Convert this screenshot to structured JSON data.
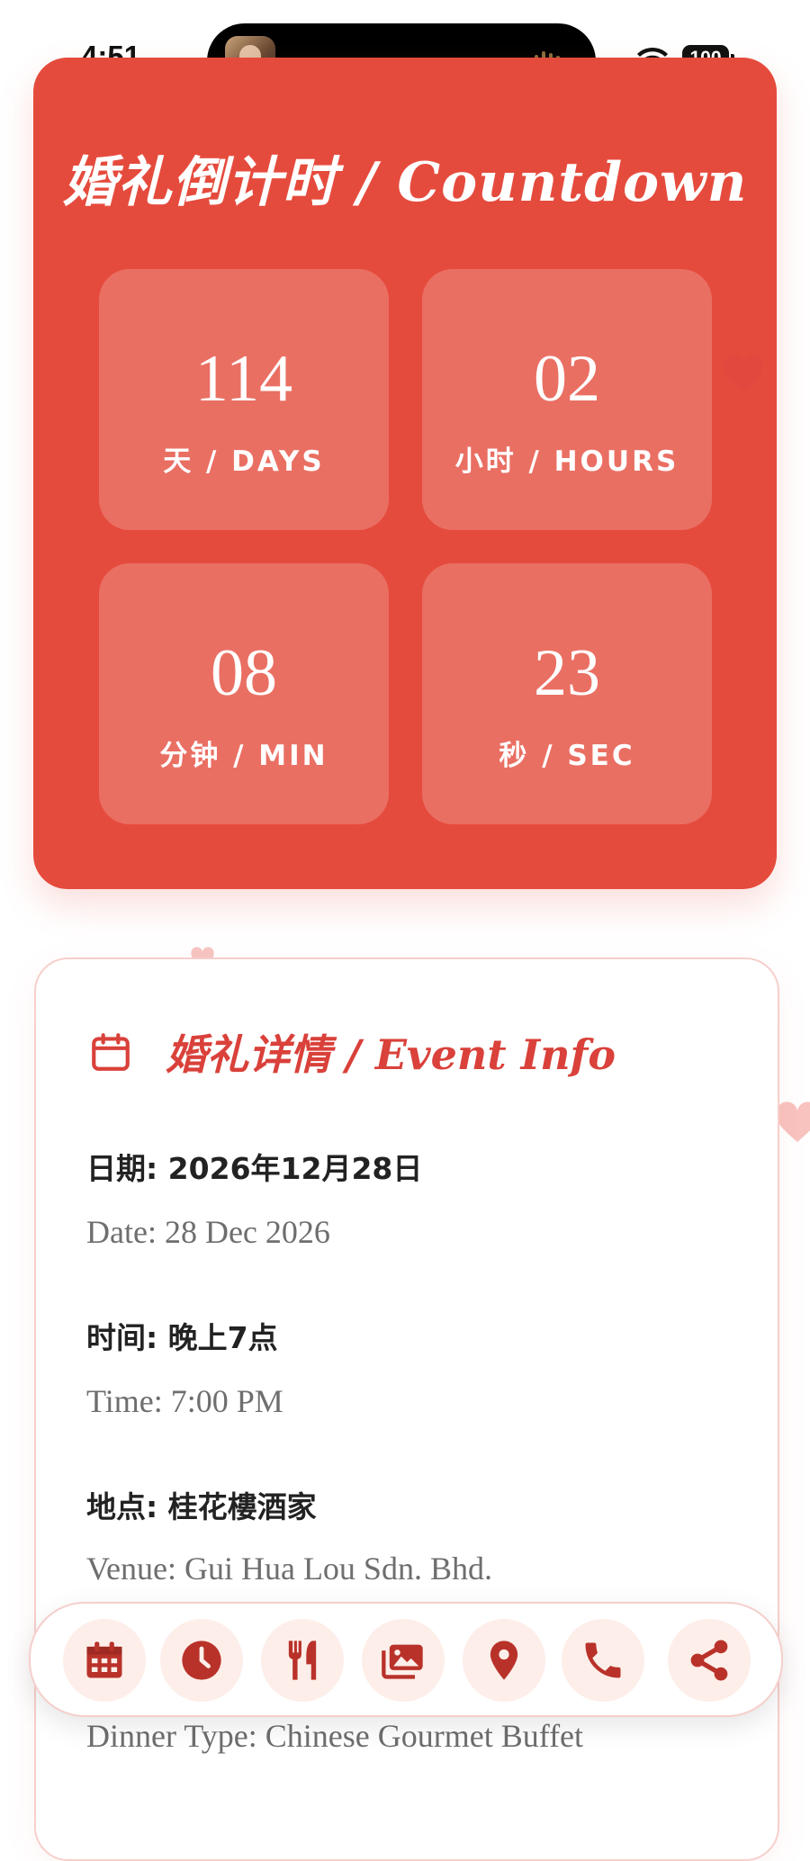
{
  "status_bar": {
    "time": "4:51",
    "battery": "100"
  },
  "countdown": {
    "title": "婚礼倒计时 / Countdown",
    "items": [
      {
        "value": "114",
        "label": "天 / DAYS"
      },
      {
        "value": "02",
        "label": "小时 / HOURS"
      },
      {
        "value": "08",
        "label": "分钟 / MIN"
      },
      {
        "value": "23",
        "label": "秒 / SEC"
      }
    ]
  },
  "event_info": {
    "title": "婚礼详情 / Event Info",
    "icon": "calendar-icon",
    "rows": [
      {
        "zh": "日期: 2026年12月28日",
        "en": "Date: 28 Dec 2026"
      },
      {
        "zh": "时间: 晚上7点",
        "en": "Time: 7:00 PM"
      },
      {
        "zh": "地点: 桂花樓酒家",
        "en": "Venue: Gui Hua Lou Sdn. Bhd."
      },
      {
        "en": "Dinner Type: Chinese Gourmet Buffet"
      }
    ]
  },
  "bottom_nav": {
    "items": [
      "calendar-icon",
      "clock-icon",
      "utensils-icon",
      "gallery-icon",
      "map-pin-icon",
      "phone-icon",
      "share-icon"
    ]
  },
  "colors": {
    "accent": "#e54b3d",
    "title_red": "#d9413a",
    "nav_icon": "#b9322a",
    "nav_bg": "#fdeee9"
  }
}
